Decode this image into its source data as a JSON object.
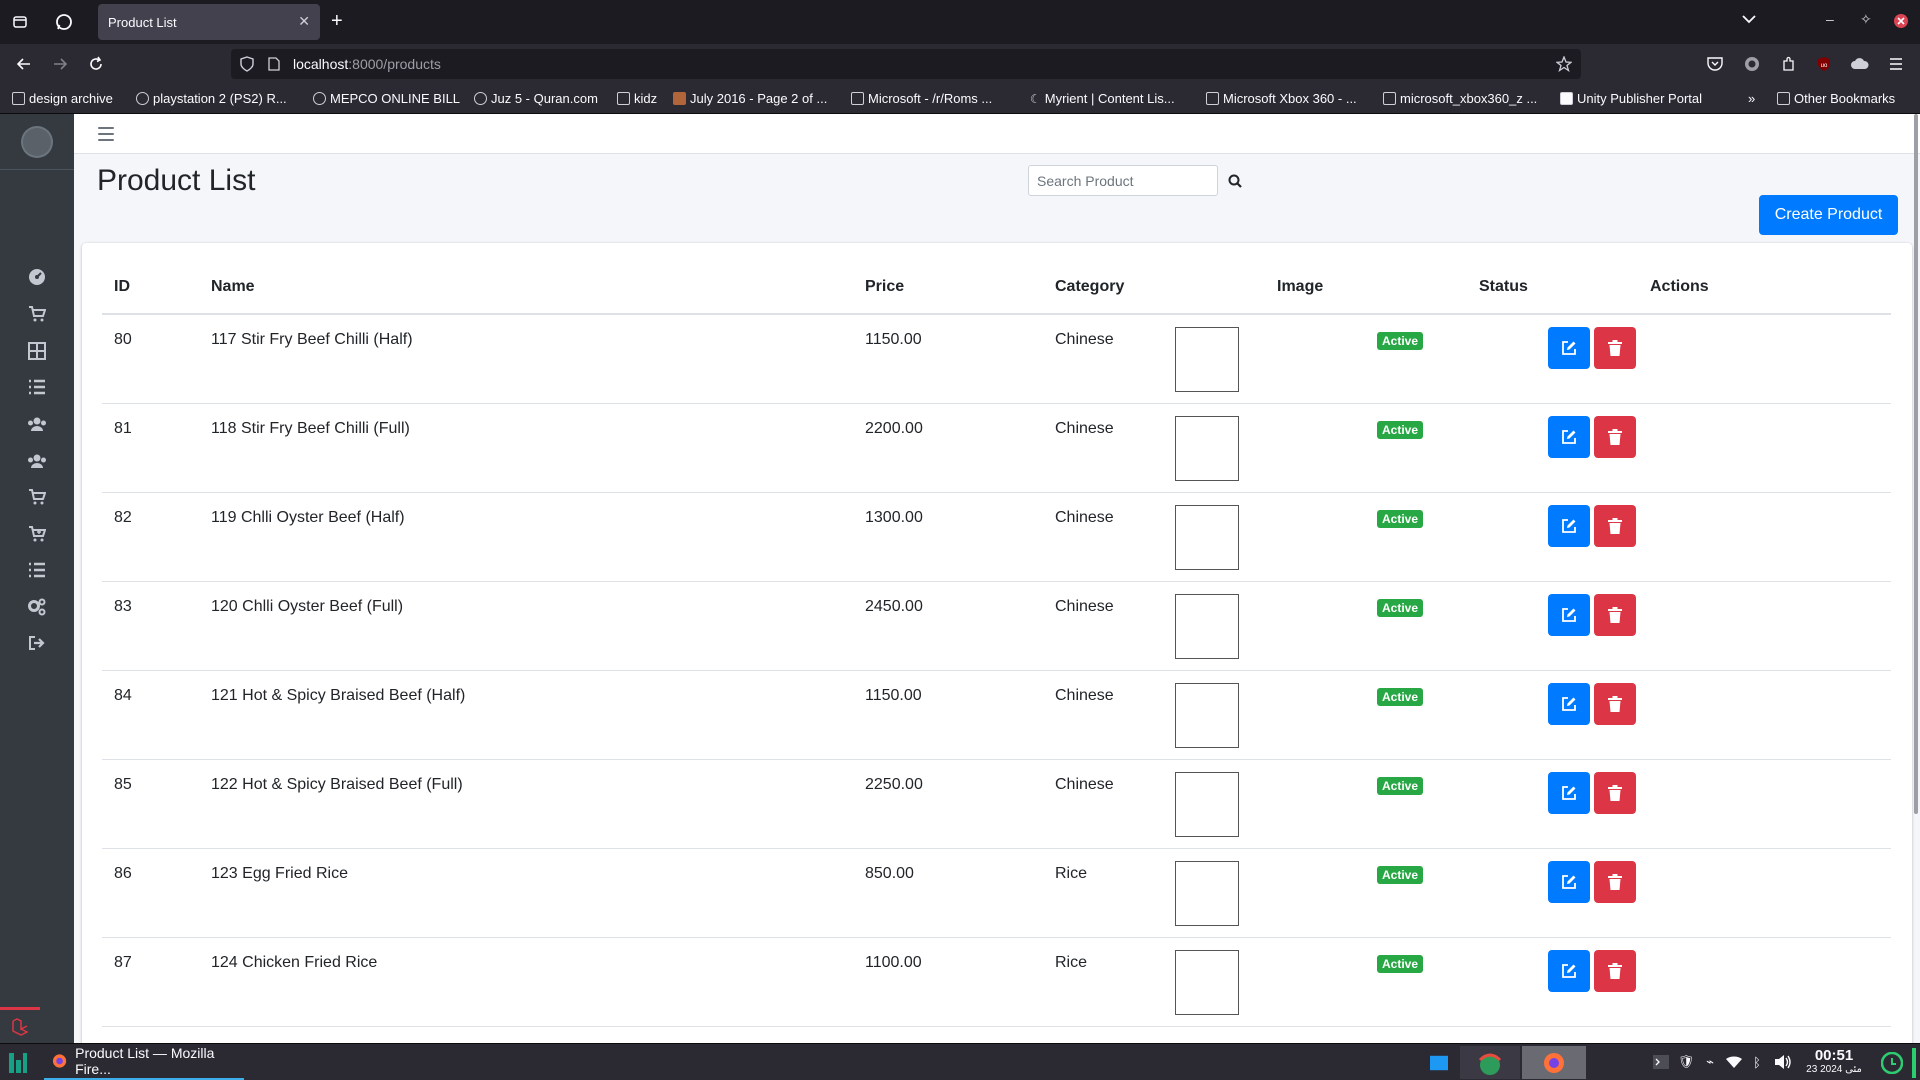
{
  "browser": {
    "tab_title": "Product List",
    "url_host": "localhost",
    "url_path": ":8000/products",
    "bookmarks": [
      "design archive",
      "playstation 2 (PS2) R...",
      "MEPCO ONLINE BILL",
      "Juz 5 - Quran.com",
      "kidz",
      "July 2016 - Page 2 of ...",
      "Microsoft - /r/Roms ...",
      "Myrient | Content Lis...",
      "Microsoft Xbox 360 - ...",
      "microsoft_xbox360_z ...",
      "Unity Publisher Portal"
    ],
    "other_bookmarks": "Other Bookmarks"
  },
  "page": {
    "title": "Product List",
    "search_placeholder": "Search Product",
    "create_label": "Create Product"
  },
  "table": {
    "headers": [
      "ID",
      "Name",
      "Price",
      "Category",
      "Image",
      "Status",
      "Actions"
    ],
    "rows": [
      {
        "id": "80",
        "name": "117 Stir Fry Beef Chilli (Half)",
        "price": "1150.00",
        "category": "Chinese",
        "status": "Active"
      },
      {
        "id": "81",
        "name": "118 Stir Fry Beef Chilli (Full)",
        "price": "2200.00",
        "category": "Chinese",
        "status": "Active"
      },
      {
        "id": "82",
        "name": "119 Chlli Oyster Beef (Half)",
        "price": "1300.00",
        "category": "Chinese",
        "status": "Active"
      },
      {
        "id": "83",
        "name": "120 Chlli Oyster Beef (Full)",
        "price": "2450.00",
        "category": "Chinese",
        "status": "Active"
      },
      {
        "id": "84",
        "name": "121 Hot & Spicy Braised Beef (Half)",
        "price": "1150.00",
        "category": "Chinese",
        "status": "Active"
      },
      {
        "id": "85",
        "name": "122 Hot & Spicy Braised Beef (Full)",
        "price": "2250.00",
        "category": "Chinese",
        "status": "Active"
      },
      {
        "id": "86",
        "name": "123 Egg Fried Rice",
        "price": "850.00",
        "category": "Rice",
        "status": "Active"
      },
      {
        "id": "87",
        "name": "124 Chicken Fried Rice",
        "price": "1100.00",
        "category": "Rice",
        "status": "Active"
      }
    ]
  },
  "sidebar_icons": [
    "dashboard-icon",
    "cart-icon",
    "grid-icon",
    "list-icon",
    "users-icon",
    "users-icon",
    "cart-icon",
    "cart-plus-icon",
    "list-icon",
    "settings-icon",
    "logout-icon"
  ],
  "taskbar": {
    "window_title": "Product List — Mozilla Fire...",
    "time": "00:51",
    "date": "23 مئی 2024"
  },
  "colors": {
    "primary": "#007bff",
    "danger": "#dc3545",
    "success": "#28a745",
    "sidebar": "#343a40"
  }
}
